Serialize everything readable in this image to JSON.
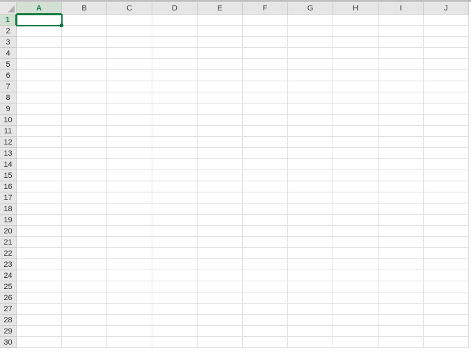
{
  "spreadsheet": {
    "columns": [
      "A",
      "B",
      "C",
      "D",
      "E",
      "F",
      "G",
      "H",
      "I",
      "J"
    ],
    "row_count": 30,
    "selected_cell": {
      "col": "A",
      "row": 1
    },
    "accent_color": "#107c41",
    "cells": {}
  }
}
